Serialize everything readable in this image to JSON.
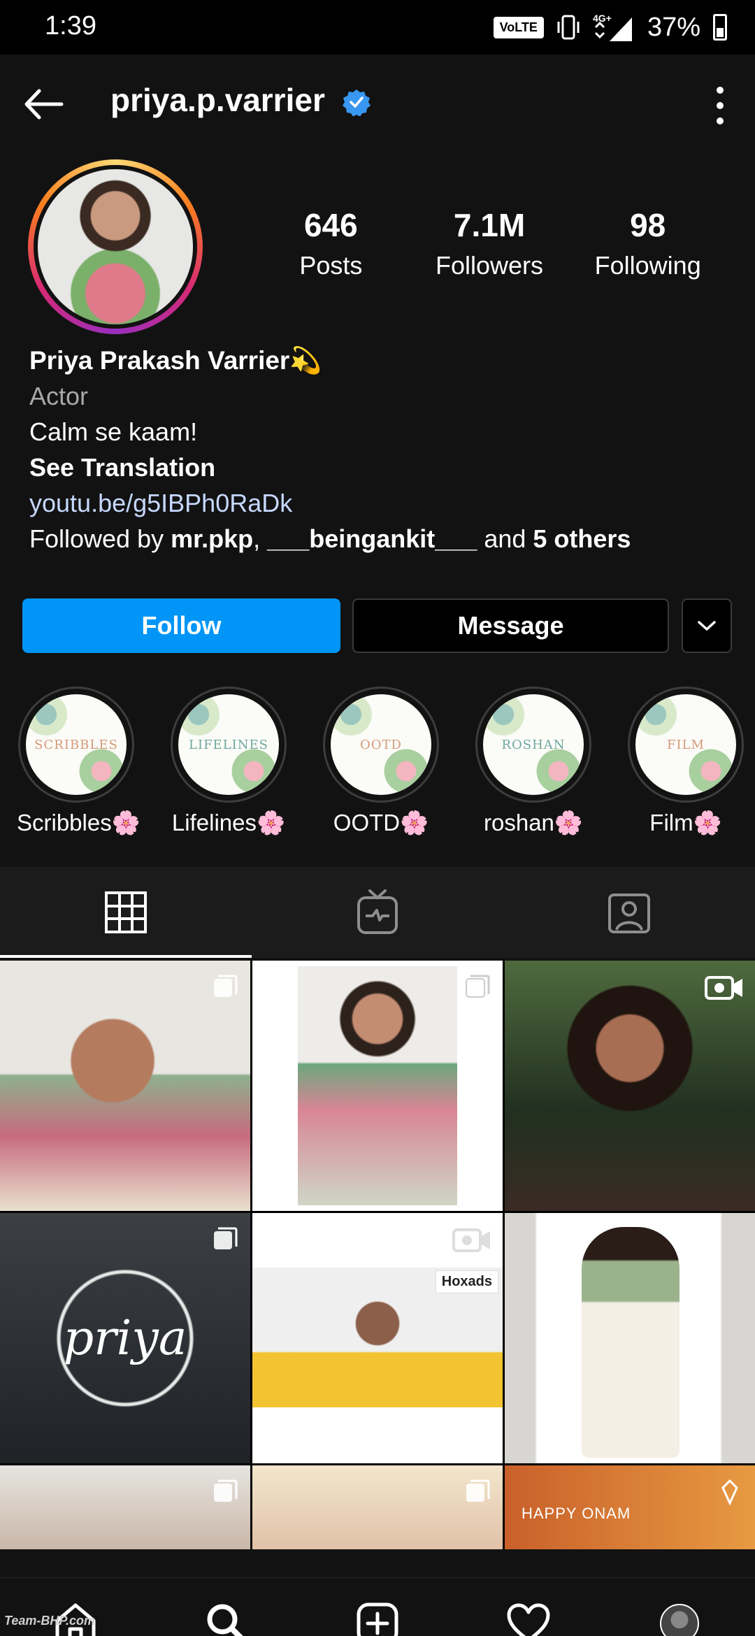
{
  "status_bar": {
    "time": "1:39",
    "network_badge": "VoLTE",
    "network_type": "4G+",
    "battery": "37%"
  },
  "header": {
    "username": "priya.p.varrier"
  },
  "profile": {
    "stats": [
      {
        "value": "646",
        "label": "Posts"
      },
      {
        "value": "7.1M",
        "label": "Followers"
      },
      {
        "value": "98",
        "label": "Following"
      }
    ],
    "display_name": "Priya Prakash Varrier💫",
    "category": "Actor",
    "bio": "Calm se kaam!",
    "see_translation": "See Translation",
    "link": "youtu.be/g5IBPh0RaDk",
    "followed_by_prefix": "Followed by ",
    "followed_by_user1": "mr.pkp",
    "followed_by_sep": ", ",
    "followed_by_user2": "___beingankit___",
    "followed_by_and": " and ",
    "followed_by_others": "5 others"
  },
  "actions": {
    "follow": "Follow",
    "message": "Message"
  },
  "highlights": [
    {
      "cover_text": "SCRIBBLES",
      "label": "Scribbles🌸",
      "color": "#d49a7a"
    },
    {
      "cover_text": "LIFELINES",
      "label": "Lifelines🌸",
      "color": "#6fa7a0"
    },
    {
      "cover_text": "OOTD",
      "label": "OOTD🌸",
      "color": "#d49a7a"
    },
    {
      "cover_text": "ROSHAN",
      "label": "roshan🌸",
      "color": "#6fa7a0"
    },
    {
      "cover_text": "FILM",
      "label": "Film🌸",
      "color": "#d49a7a"
    }
  ],
  "tabs": [
    "grid-icon",
    "igtv-icon",
    "tagged-icon"
  ],
  "grid": {
    "p4_text": "priya",
    "p5_logo": "Hoxads",
    "p9_text": "HAPPY ONAM"
  },
  "bottom_nav": [
    "home-icon",
    "search-icon",
    "add-post-icon",
    "activity-heart-icon",
    "profile-avatar"
  ],
  "watermark": "Team-BHP.com",
  "colors": {
    "accent": "#0095f6",
    "background": "#121212",
    "verified": "#3897f0"
  }
}
